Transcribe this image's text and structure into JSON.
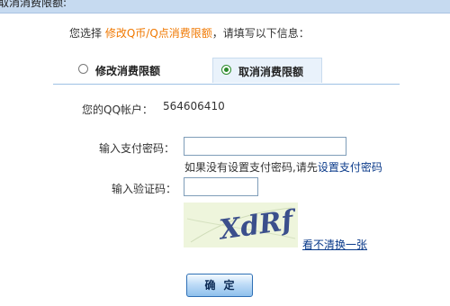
{
  "header": {
    "title": "取消消费限额:"
  },
  "intro": {
    "prefix": "您选择",
    "action": "修改Q币/Q点消费限额",
    "suffix": "，请填写以下信息："
  },
  "options": {
    "modify": {
      "label": "修改消费限额",
      "selected": false
    },
    "cancel": {
      "label": "取消消费限额",
      "selected": true
    }
  },
  "account": {
    "label": "您的QQ帐户：",
    "value": "564606410"
  },
  "password": {
    "label": "输入支付密码：",
    "value": "",
    "hint_text": "如果没有设置支付密码,请先",
    "hint_link": "设置支付密码"
  },
  "captcha": {
    "label": "输入验证码：",
    "value": "",
    "image_text": "XdRf",
    "refresh_link": "看不清换一张"
  },
  "confirm": {
    "label": "确定"
  },
  "colors": {
    "highlight": "#f07800",
    "link": "#0a3a8a",
    "captcha_ink": "#3b4f8c",
    "divider": "#9ec1e4"
  }
}
